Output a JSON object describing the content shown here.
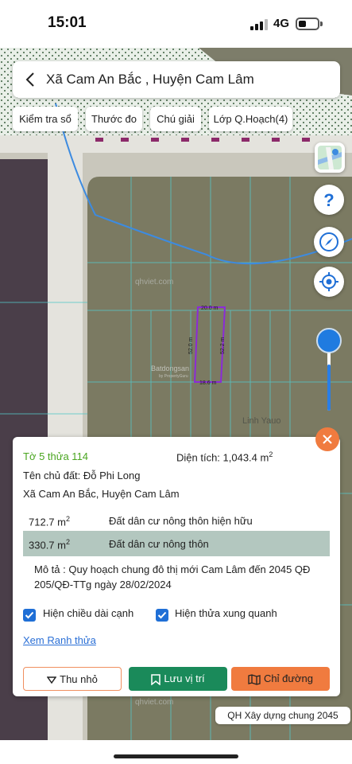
{
  "status": {
    "time": "15:01",
    "network": "4G"
  },
  "header": {
    "title": "Xã Cam An Bắc , Huyện Cam Lâm"
  },
  "toolbar": {
    "check_label": "Kiểm tra sổ",
    "measure_label": "Thước đo",
    "legend_label": "Chú giải",
    "layers_label": "Lớp Q.Hoạch(4)"
  },
  "map": {
    "watermark_top": "qhviet.com",
    "watermark_bottom": "qhviet.com",
    "edge_top": "20.0 m",
    "edge_bottom": "18.6 m",
    "edge_left": "52.0 m",
    "edge_right": "52.2 m",
    "brand_watermark": "Batdongsan",
    "brand_sub": "by PropertyGuru",
    "place_label": "Linh Yauo"
  },
  "panel": {
    "parcel_id": "Tờ 5 thửa 114",
    "area_label": "Diện tích: 1,043.4 m",
    "area_sup": "2",
    "owner": "Tên chủ đất: Đỗ Phi Long",
    "address": "Xã Cam An Bắc, Huyện Cam Lâm",
    "rows": [
      {
        "area": "712.7 m",
        "sup": "2",
        "type": "Đất dân cư nông thôn hiện hữu"
      },
      {
        "area": "330.7 m",
        "sup": "2",
        "type": "Đất dân cư nông thôn"
      }
    ],
    "description": "Mô tả : Quy hoạch chung đô thị mới Cam Lâm đến 2045 QĐ 205/QĐ-TTg ngày 28/02/2024",
    "option_edges": "Hiện chiều dài cạnh",
    "option_neighbors": "Hiện thửa xung quanh",
    "boundary_link": "Xem Ranh thửa",
    "btn_shrink": "Thu nhỏ",
    "btn_save": "Lưu vị trí",
    "btn_directions": "Chỉ đường"
  },
  "zoom": {
    "level": 0.4
  },
  "plan_label": "QH Xây dựng chung 2045",
  "colors": {
    "accent": "#f07b3f",
    "save": "#1a8a5a",
    "link": "#2a6fd6",
    "parcel_id": "#4aa520"
  }
}
